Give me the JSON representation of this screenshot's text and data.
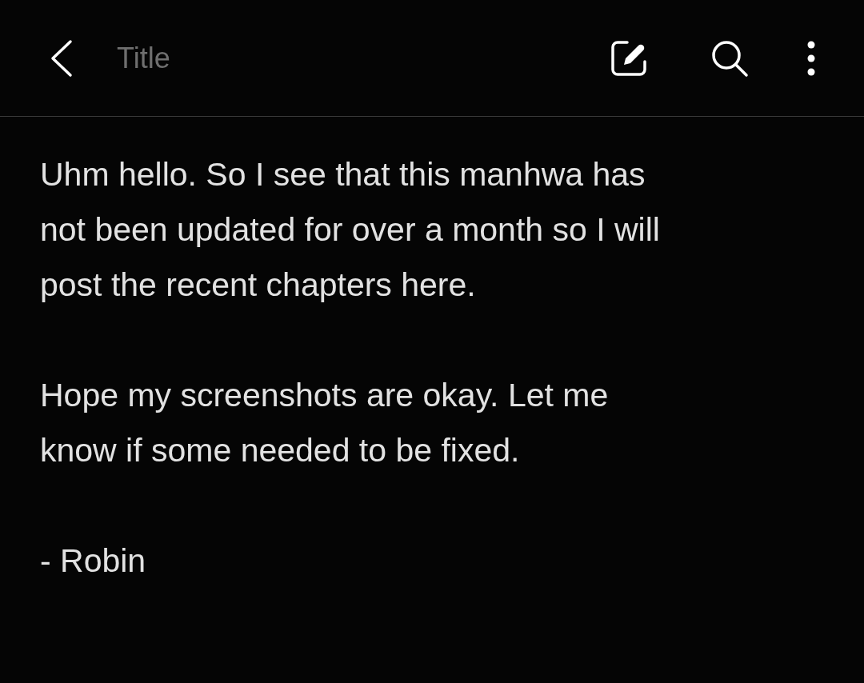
{
  "toolbar": {
    "title": {
      "placeholder": "Title"
    }
  },
  "note": {
    "paragraphs": [
      {
        "lines": [
          "Uhm hello. So I see that this manhwa has",
          "not been updated for over a month so I will",
          "post the recent chapters here."
        ]
      },
      {
        "lines": [
          "Hope my screenshots are okay. Let me",
          "know if some needed to be fixed."
        ]
      },
      {
        "lines": [
          "- Robin"
        ]
      }
    ]
  }
}
